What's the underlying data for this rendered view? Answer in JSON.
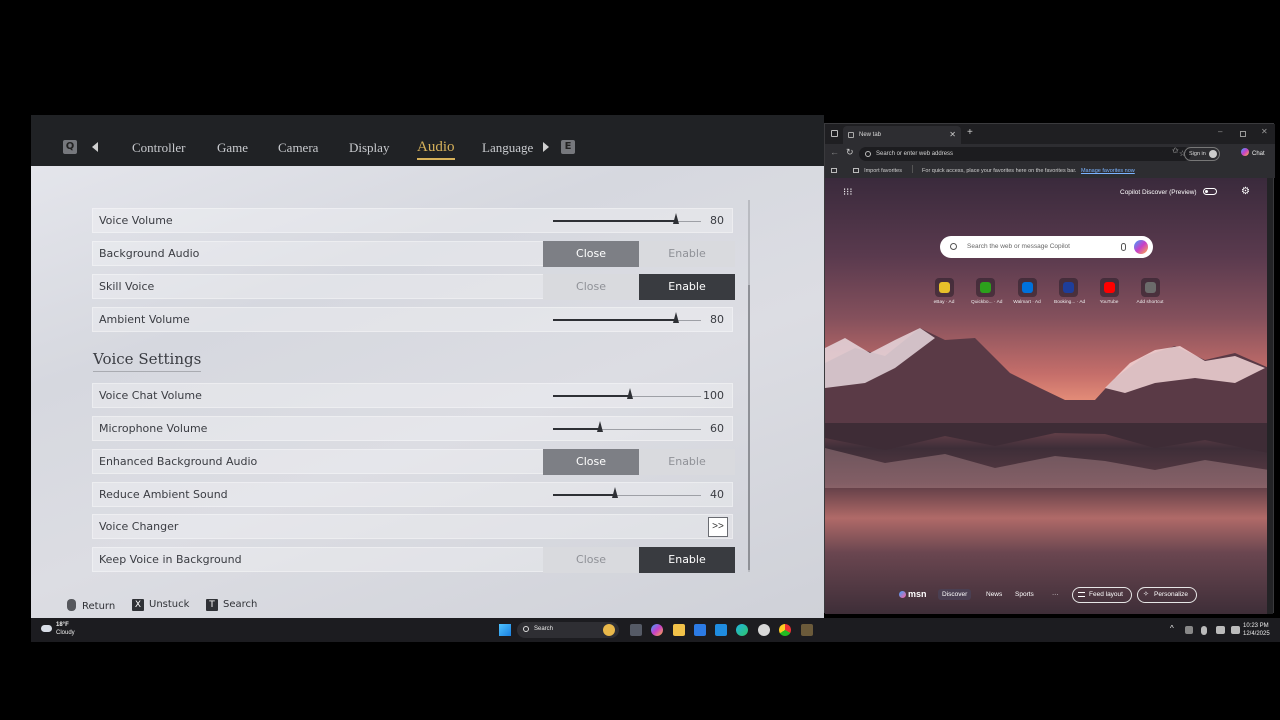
{
  "game": {
    "key_left": "Q",
    "key_right": "E",
    "tabs": [
      "Controller",
      "Game",
      "Camera",
      "Display",
      "Audio",
      "Language"
    ],
    "active_tab": "Audio",
    "rows": {
      "voice_volume": {
        "label": "Voice Volume",
        "value": "80",
        "level": 0.82
      },
      "background_audio": {
        "label": "Background Audio",
        "close": "Close",
        "enable": "Enable",
        "selected": "Close"
      },
      "skill_voice": {
        "label": "Skill Voice",
        "close": "Close",
        "enable": "Enable",
        "selected": "Enable"
      },
      "ambient_volume": {
        "label": "Ambient Volume",
        "value": "80",
        "level": 0.82
      },
      "voice_chat_volume": {
        "label": "Voice Chat Volume",
        "value": "100",
        "level": 0.52
      },
      "microphone_volume": {
        "label": "Microphone Volume",
        "value": "60",
        "level": 0.32
      },
      "enhanced_background_audio": {
        "label": "Enhanced Background Audio",
        "close": "Close",
        "enable": "Enable",
        "selected": "Close"
      },
      "reduce_ambient_sound": {
        "label": "Reduce Ambient Sound",
        "value": "40",
        "level": 0.42
      },
      "voice_changer": {
        "label": "Voice Changer",
        "button": ">>"
      },
      "keep_voice_in_background": {
        "label": "Keep Voice in Background",
        "close": "Close",
        "enable": "Enable",
        "selected": "Enable"
      }
    },
    "section_title": "Voice Settings",
    "footer": {
      "return_label": "Return",
      "unstuck_key": "X",
      "unstuck_label": "Unstuck",
      "search_key": "T",
      "search_label": "Search"
    }
  },
  "browser": {
    "tab_title": "New tab",
    "address_placeholder": "Search or enter web address",
    "sign_in": "Sign in",
    "chat": "Chat",
    "import_favorites": "Import favorites",
    "favorites_hint": "For quick access, place your favorites here on the favorites bar.",
    "manage_favorites": "Manage favorites now",
    "copilot_discover": "Copilot Discover (Preview)",
    "search_placeholder": "Search the web or message Copilot",
    "shortcuts": [
      {
        "name": "eBay · Ad",
        "color": "#e7c02a"
      },
      {
        "name": "Quickbo... · Ad",
        "color": "#2ca01c"
      },
      {
        "name": "Walmart · Ad",
        "color": "#0071dc"
      },
      {
        "name": "Booking... · Ad",
        "color": "#1e3e9a"
      },
      {
        "name": "YouTube",
        "color": "#ff0000"
      },
      {
        "name": "Add shortcut",
        "color": "#6b6b6b"
      }
    ],
    "bottom": {
      "brand": "msn",
      "discover": "Discover",
      "news": "News",
      "sports": "Sports",
      "more": "···",
      "feed_layout": "Feed layout",
      "personalize": "Personalize"
    }
  },
  "taskbar": {
    "weather_temp": "18°F",
    "weather_desc": "Cloudy",
    "search": "Search",
    "time": "10:23 PM",
    "date": "12/4/2025"
  }
}
